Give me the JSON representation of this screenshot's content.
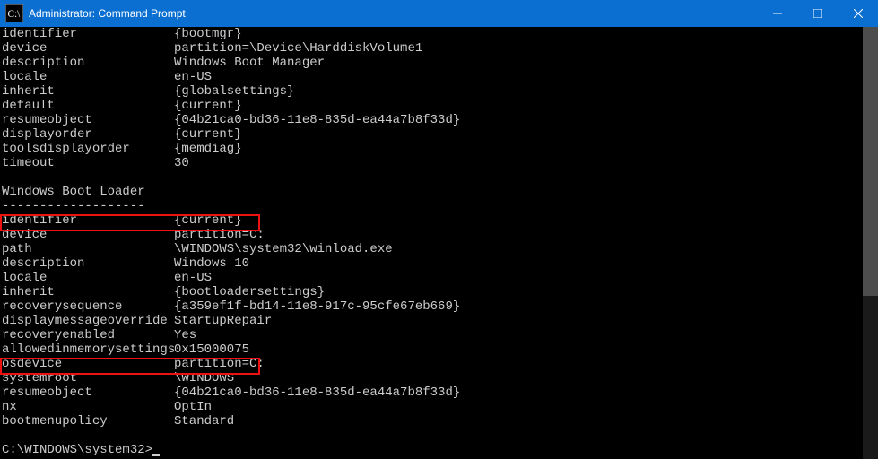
{
  "window": {
    "title": "Administrator: Command Prompt"
  },
  "sections": {
    "bootmgr": {
      "identifier": {
        "k": "identifier",
        "v": "{bootmgr}"
      },
      "device": {
        "k": "device",
        "v": "partition=\\Device\\HarddiskVolume1"
      },
      "description": {
        "k": "description",
        "v": "Windows Boot Manager"
      },
      "locale": {
        "k": "locale",
        "v": "en-US"
      },
      "inherit": {
        "k": "inherit",
        "v": "{globalsettings}"
      },
      "default": {
        "k": "default",
        "v": "{current}"
      },
      "resumeobject": {
        "k": "resumeobject",
        "v": "{04b21ca0-bd36-11e8-835d-ea44a7b8f33d}"
      },
      "displayorder": {
        "k": "displayorder",
        "v": "{current}"
      },
      "toolsdisplayorder": {
        "k": "toolsdisplayorder",
        "v": "{memdiag}"
      },
      "timeout": {
        "k": "timeout",
        "v": "30"
      }
    },
    "loader_header": "Windows Boot Loader",
    "loader_divider": "-------------------",
    "loader": {
      "identifier": {
        "k": "identifier",
        "v": "{current}"
      },
      "device": {
        "k": "device",
        "v": "partition=C:"
      },
      "path": {
        "k": "path",
        "v": "\\WINDOWS\\system32\\winload.exe"
      },
      "description": {
        "k": "description",
        "v": "Windows 10"
      },
      "locale": {
        "k": "locale",
        "v": "en-US"
      },
      "inherit": {
        "k": "inherit",
        "v": "{bootloadersettings}"
      },
      "recoverysequence": {
        "k": "recoverysequence",
        "v": "{a359ef1f-bd14-11e8-917c-95cfe67eb669}"
      },
      "displaymessageoverride": {
        "k": "displaymessageoverride",
        "v": "StartupRepair"
      },
      "recoveryenabled": {
        "k": "recoveryenabled",
        "v": "Yes"
      },
      "allowedinmemorysettings": {
        "k": "allowedinmemorysettings",
        "v": "0x15000075"
      },
      "osdevice": {
        "k": "osdevice",
        "v": "partition=C:"
      },
      "systemroot": {
        "k": "systemroot",
        "v": "\\WINDOWS"
      },
      "resumeobject": {
        "k": "resumeobject",
        "v": "{04b21ca0-bd36-11e8-835d-ea44a7b8f33d}"
      },
      "nx": {
        "k": "nx",
        "v": "OptIn"
      },
      "bootmenupolicy": {
        "k": "bootmenupolicy",
        "v": "Standard"
      }
    },
    "prompt": "C:\\WINDOWS\\system32>"
  }
}
